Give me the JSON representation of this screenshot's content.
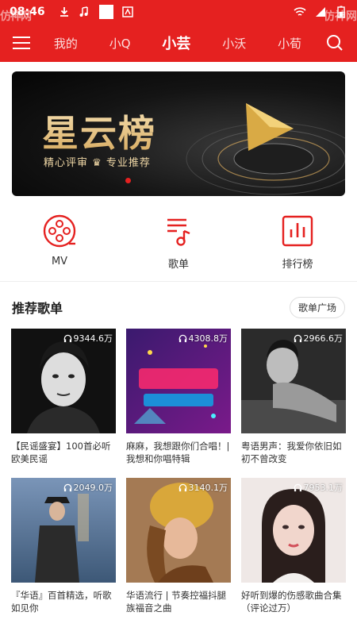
{
  "status_bar": {
    "time": "08:46",
    "watermark": "仿神网"
  },
  "nav": {
    "tabs": [
      {
        "label": "我的"
      },
      {
        "label": "小Q"
      },
      {
        "label": "小芸"
      },
      {
        "label": "小沃"
      },
      {
        "label": "小荀"
      }
    ],
    "active_index": 2
  },
  "banner": {
    "title": "星云榜",
    "subtitle": "精心评审 ♛ 专业推荐",
    "accent": "#e52120"
  },
  "quick_entries": [
    {
      "label": "MV",
      "icon": "film-reel-icon"
    },
    {
      "label": "歌单",
      "icon": "playlist-icon"
    },
    {
      "label": "排行榜",
      "icon": "bar-chart-icon"
    }
  ],
  "section": {
    "title": "推荐歌单",
    "more_label": "歌单广场"
  },
  "playlists": [
    {
      "count": "9344.6万",
      "title": "【民谣盛宴】100首必听欧美民谣"
    },
    {
      "count": "4308.8万",
      "title": "麻麻，我想跟你们合唱！| 我想和你唱特辑"
    },
    {
      "count": "2966.6万",
      "title": "粤语男声：我爱你依旧如初不曾改变"
    },
    {
      "count": "2049.0万",
      "title": "『华语』百首精选，听歌如见你"
    },
    {
      "count": "3140.1万",
      "title": "华语流行 | 节奏控福抖腿族福音之曲"
    },
    {
      "count": "7953.1万",
      "title": "好听到爆的伤感歌曲合集（评论过万）"
    }
  ],
  "colors": {
    "brand_red": "#e52120"
  }
}
